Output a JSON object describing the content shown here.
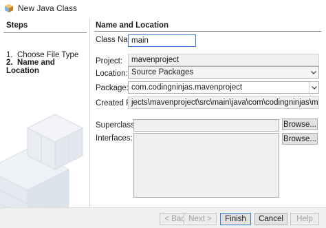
{
  "window": {
    "title": "New Java Class",
    "icon": "netbeans-cube-icon"
  },
  "steps": {
    "heading": "Steps",
    "items": [
      {
        "num": "1.",
        "label": "Choose File Type"
      },
      {
        "num": "2.",
        "label": "Name and Location"
      }
    ]
  },
  "content": {
    "heading": "Name and Location"
  },
  "form": {
    "class_name_label": "Class Name:",
    "class_name_value": "main",
    "project_label": "Project:",
    "project_value": "mavenproject",
    "location_label": "Location:",
    "location_value": "Source Packages",
    "package_label": "Package:",
    "package_value": "com.codingninjas.mavenproject",
    "created_file_label": "Created File:",
    "created_file_value": "jects\\mavenproject\\src\\main\\java\\com\\codingninjas\\mavenproject\\main.java",
    "superclass_label": "Superclass:",
    "superclass_value": "",
    "interfaces_label": "Interfaces:",
    "browse_label": "Browse..."
  },
  "buttons": {
    "back": "< Back",
    "next": "Next >",
    "finish": "Finish",
    "cancel": "Cancel",
    "help": "Help"
  },
  "colors": {
    "accent": "#3c7fd8",
    "dialog_bg": "#ffffff",
    "button_bg": "#e1e1e1"
  }
}
